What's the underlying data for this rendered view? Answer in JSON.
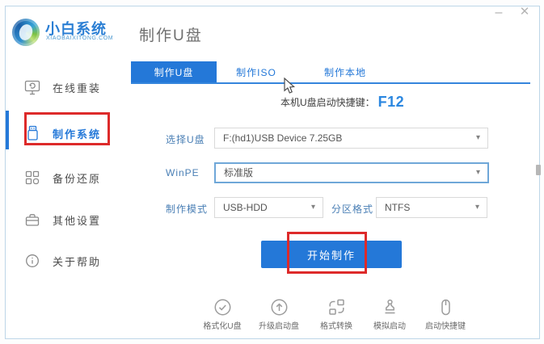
{
  "window": {
    "brand_name": "小白系统",
    "brand_domain": "XIAOBAIXITONG.COM",
    "page_title": "制作U盘",
    "controls": {
      "minimize": "–",
      "close": "✕"
    }
  },
  "sidebar": {
    "items": [
      {
        "label": "在线重装"
      },
      {
        "label": "制作系统"
      },
      {
        "label": "备份还原"
      },
      {
        "label": "其他设置"
      },
      {
        "label": "关于帮助"
      }
    ]
  },
  "tabs": [
    {
      "label": "制作U盘",
      "active": true
    },
    {
      "label": "制作ISO",
      "active": false
    },
    {
      "label": "制作本地",
      "active": false
    }
  ],
  "main": {
    "hotkey_label": "本机U盘启动快捷键：",
    "hotkey_value": "F12",
    "form": {
      "udisk_label": "选择U盘",
      "udisk_value": "F:(hd1)USB Device 7.25GB",
      "winpe_label": "WinPE",
      "winpe_value": "标准版",
      "mode_label": "制作模式",
      "mode_value": "USB-HDD",
      "partition_label": "分区格式",
      "partition_value": "NTFS"
    },
    "start_button": "开始制作"
  },
  "toolbar": {
    "items": [
      {
        "label": "格式化U盘",
        "icon": "check-circle-icon"
      },
      {
        "label": "升级启动盘",
        "icon": "arrow-up-circle-icon"
      },
      {
        "label": "格式转换",
        "icon": "convert-icon"
      },
      {
        "label": "模拟启动",
        "icon": "stamp-icon"
      },
      {
        "label": "启动快捷键",
        "icon": "mouse-icon"
      }
    ]
  },
  "icons": {
    "chevron_down": "▾"
  },
  "colors": {
    "primary_blue": "#2478d8",
    "label_blue": "#4a7fb5",
    "hotkey_blue": "#2b87e0",
    "annotation_red": "#dd2a2a",
    "window_border": "#bdd6e8"
  }
}
